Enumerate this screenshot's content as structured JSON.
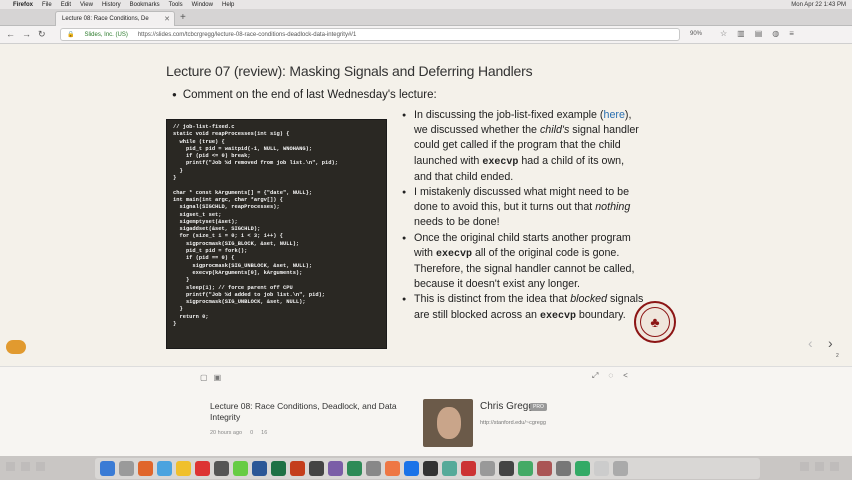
{
  "menubar": {
    "items": [
      "Firefox",
      "File",
      "Edit",
      "View",
      "History",
      "Bookmarks",
      "Tools",
      "Window",
      "Help"
    ],
    "clock": "Mon Apr 22  1:43 PM"
  },
  "tab": {
    "title": "Lecture 08: Race Conditions, De"
  },
  "navbar": {
    "site": "Slides, Inc. (US)",
    "url": "https://slides.com/tcbcrgregg/lecture-08-race-conditions-deadlock-data-integrity#/1",
    "zoom": "90%"
  },
  "slide": {
    "title": "Lecture 07 (review): Masking Signals and Deferring Handlers",
    "main_bullet": "Comment on the end of last Wednesday's lecture:",
    "code": "// job-list-fixed.c\nstatic void reapProcesses(int sig) {\n  while (true) {\n    pid_t pid = waitpid(-1, NULL, WNOHANG);\n    if (pid <= 0) break;\n    printf(\"Job %d removed from job list.\\n\", pid);\n  }\n}\n\nchar * const kArguments[] = {\"date\", NULL};\nint main(int argc, char *argv[]) {\n  signal(SIGCHLD, reapProcesses);\n  sigset_t set;\n  sigemptyset(&set);\n  sigaddset(&set, SIGCHLD);\n  for (size_t i = 0; i < 3; i++) {\n    sigprocmask(SIG_BLOCK, &set, NULL);\n    pid_t pid = fork();\n    if (pid == 0) {\n      sigprocmask(SIG_UNBLOCK, &set, NULL);\n      execvp(kArguments[0], kArguments);\n    }\n    sleep(1); // force parent off CPU\n    printf(\"Job %d added to job list.\\n\", pid);\n    sigprocmask(SIG_UNBLOCK, &set, NULL);\n  }\n  return 0;\n}",
    "b1_pre": "In discussing the job-list-fixed example (",
    "b1_link": "here",
    "b1_mid1": "), we discussed whether the ",
    "b1_em": "child's",
    "b1_mid2": " signal handler could get called if the program that the child launched with ",
    "b1_code": "execvp",
    "b1_post": " had a child of its own, and that child ended.",
    "b2_pre": "I mistakenly discussed what might need to be done to avoid this, but it turns out that ",
    "b2_em": "nothing",
    "b2_post": " needs to be done!",
    "b3_pre": "Once the original child starts another program with ",
    "b3_code": "execvp",
    "b3_post": " all of the original code is gone. Therefore, the signal handler cannot be called, because it doesn't exist any longer.",
    "b4_pre": "This is distinct from the idea that ",
    "b4_em": "blocked",
    "b4_mid": " signals are still blocked across an ",
    "b4_code": "execvp",
    "b4_post": " boundary.",
    "page_number": "2"
  },
  "deck": {
    "title": "Lecture 08: Race Conditions, Deadlock, and Data Integrity",
    "time": "20 hours ago",
    "views": "0",
    "comments": "16",
    "author": "Chris Gregg",
    "badge": "PRO",
    "author_link": "http://stanford.edu/~cgregg"
  },
  "colors": {
    "accent": "#8c1515",
    "chat": "#e19a2f"
  }
}
